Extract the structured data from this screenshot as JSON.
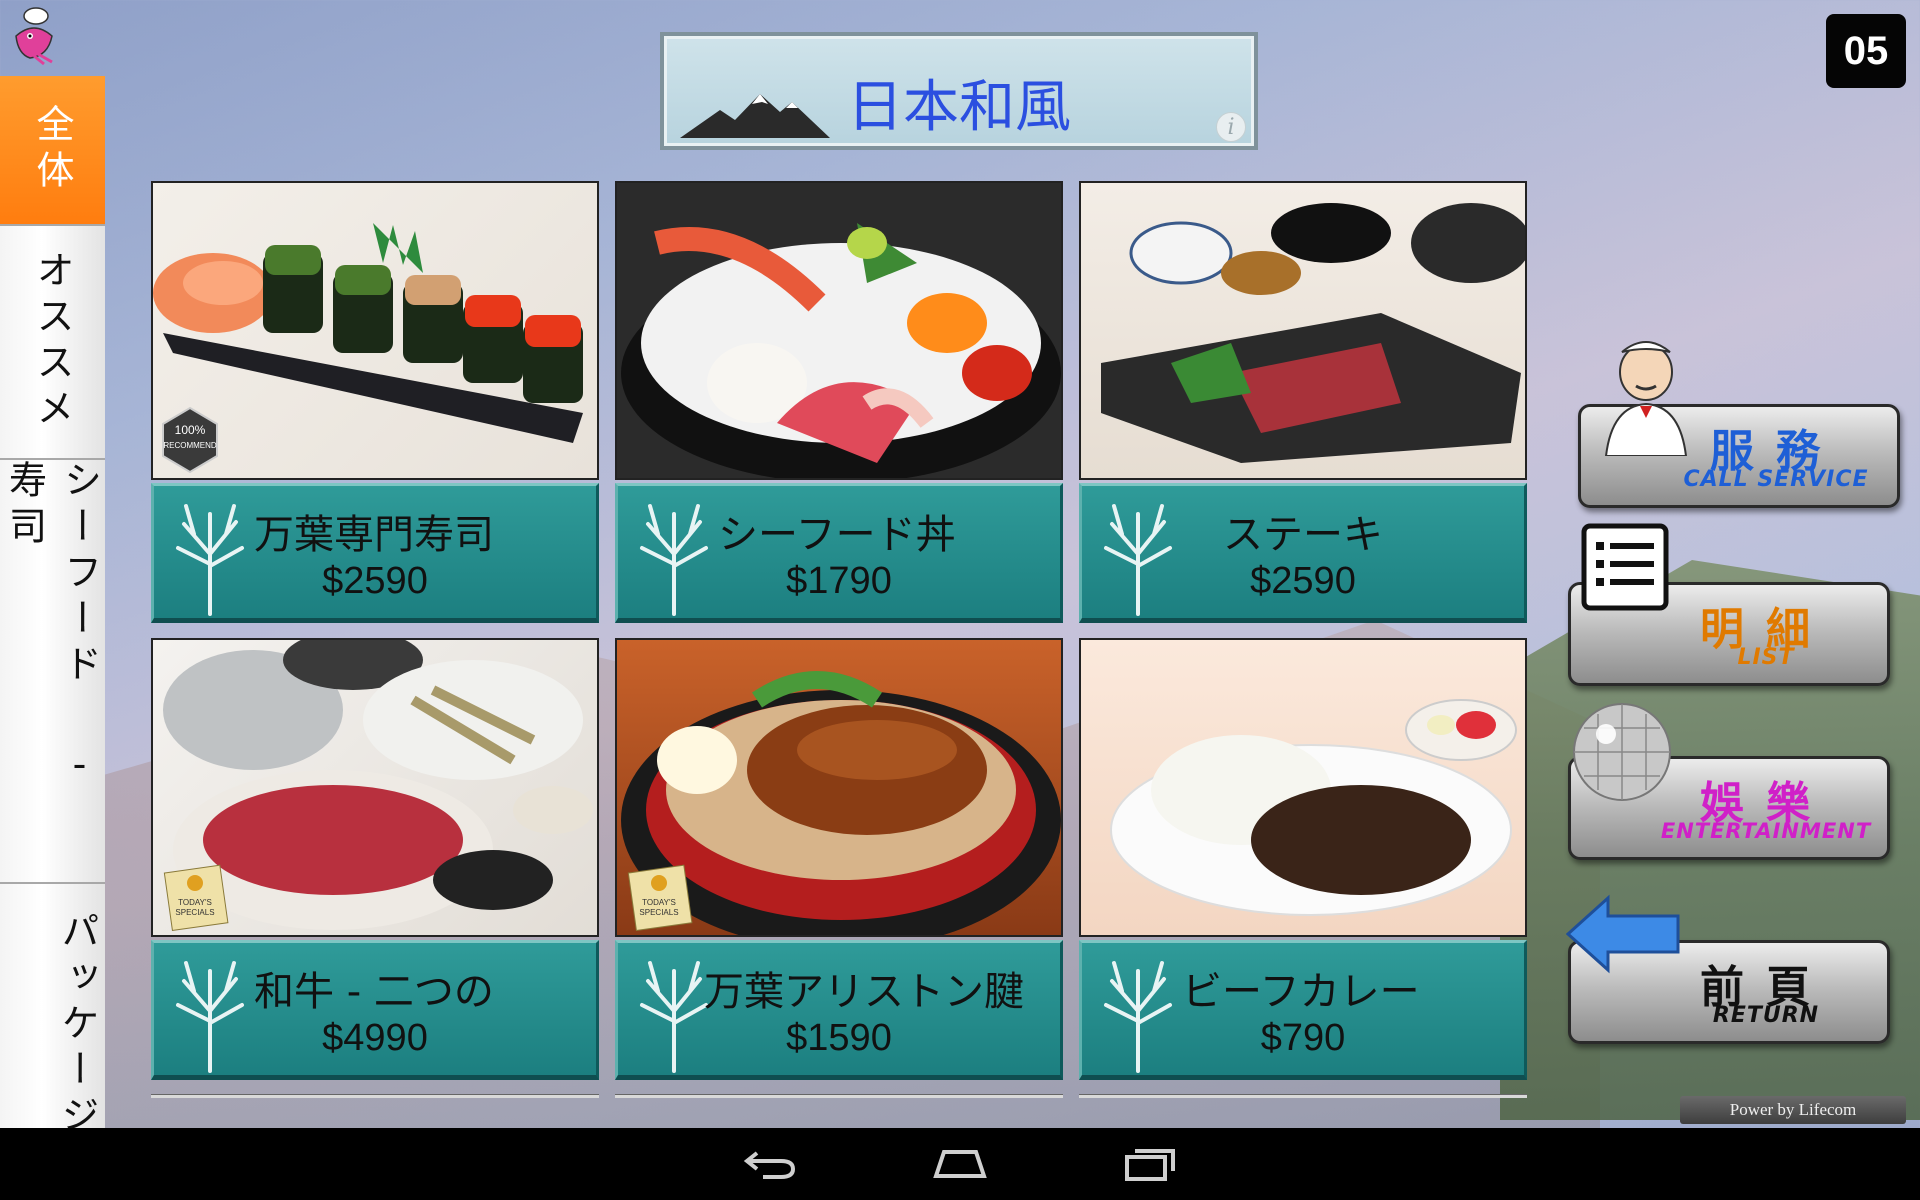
{
  "table_number": "05",
  "header": {
    "title": "日本和風"
  },
  "sidebar": {
    "categories": [
      {
        "label": "全体",
        "active": true
      },
      {
        "label": "オススメ",
        "active": false
      },
      {
        "label": "シーフード - 寿司",
        "active": false
      },
      {
        "label": "パッケージ",
        "active": false
      }
    ]
  },
  "menu": {
    "items": [
      {
        "name": "万葉専門寿司",
        "price": "$2590",
        "badge": "100% RECOMMEND"
      },
      {
        "name": "シーフード丼",
        "price": "$1790",
        "badge": ""
      },
      {
        "name": "ステーキ",
        "price": "$2590",
        "badge": ""
      },
      {
        "name": "和牛 - 二つの",
        "price": "$4990",
        "badge": "TODAY'S SPECIALS"
      },
      {
        "name": "万葉アリストン腱",
        "price": "$1590",
        "badge": "TODAY'S SPECIALS"
      },
      {
        "name": "ビーフカレー",
        "price": "$790",
        "badge": ""
      }
    ]
  },
  "actions": {
    "service": {
      "zh": "服務",
      "en": "CALL SERVICE"
    },
    "list": {
      "zh": "明細",
      "en": "LIST"
    },
    "entertainment": {
      "zh": "娛樂",
      "en": "ENTERTAINMENT"
    },
    "return": {
      "zh": "前頁",
      "en": "RETURN"
    }
  },
  "footer": {
    "powered_by": "Power by Lifecom"
  },
  "colors": {
    "active_category": "#ff8a1c",
    "title_text": "#2b4fe0",
    "card_plate": "#2a9190",
    "service_text": "#1e5fd6",
    "list_text": "#e07a00",
    "entertainment_text": "#d020c8",
    "return_text": "#111111"
  },
  "icons": {
    "logo": "chef-shrimp-logo",
    "info": "info-icon",
    "tree": "tree-icon",
    "nav_back": "back-arrow-icon",
    "nav_home": "home-icon",
    "nav_recents": "recents-icon"
  }
}
